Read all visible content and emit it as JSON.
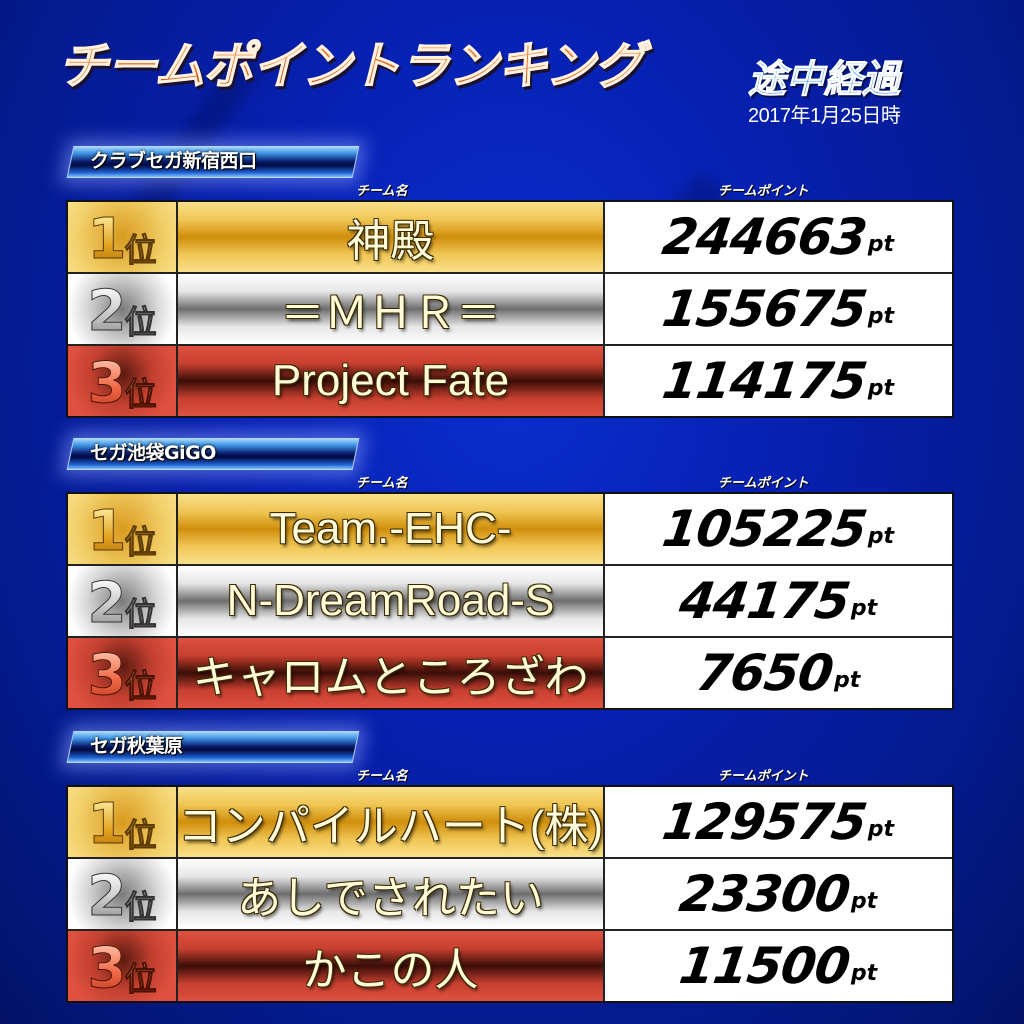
{
  "header": {
    "title": "チームポイントランキング",
    "subtitle": "途中経過",
    "date": "2017年1月25日時"
  },
  "columns": {
    "team_name": "チーム名",
    "team_points": "チームポイント"
  },
  "rank_suffix": "位",
  "points_unit": "pt",
  "colors": {
    "gold": "#f0c654",
    "silver": "#e6e6e6",
    "bronze": "#c84030",
    "background": "#0620b0"
  },
  "sections": [
    {
      "store": "クラブセガ新宿西口",
      "rows": [
        {
          "rank": "1",
          "team": "神殿",
          "points": "244663"
        },
        {
          "rank": "2",
          "team": "＝ＭＨＲ＝",
          "points": "155675"
        },
        {
          "rank": "3",
          "team": "Project Fate",
          "points": "114175"
        }
      ]
    },
    {
      "store": "セガ池袋GiGO",
      "rows": [
        {
          "rank": "1",
          "team": "Team.-EHC-",
          "points": "105225"
        },
        {
          "rank": "2",
          "team": "N-DreamRoad-S",
          "points": "44175"
        },
        {
          "rank": "3",
          "team": "キャロムところざわ",
          "points": "7650"
        }
      ]
    },
    {
      "store": "セガ秋葉原",
      "rows": [
        {
          "rank": "1",
          "team": "コンパイルハート(株)",
          "points": "129575"
        },
        {
          "rank": "2",
          "team": "あしでされたい",
          "points": "23300"
        },
        {
          "rank": "3",
          "team": "かこの人",
          "points": "11500"
        }
      ]
    }
  ]
}
